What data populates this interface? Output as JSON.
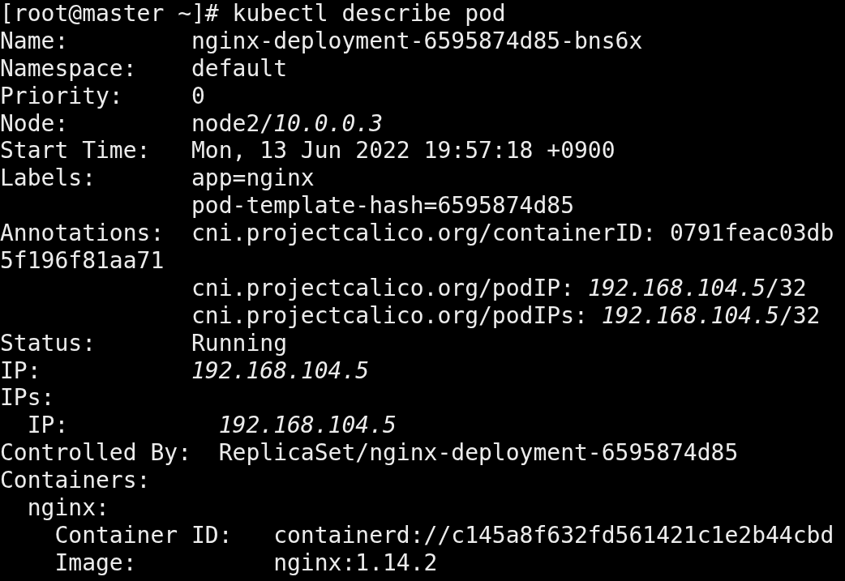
{
  "terminal": {
    "lines": [
      "[root@master ~]# kubectl describe pod",
      "Name:         nginx-deployment-6595874d85-bns6x",
      "Namespace:    default",
      "Priority:     0",
      "Node:         node2/*10.0.0.3*",
      "Start Time:   Mon, 13 Jun 2022 19:57:18 +0900",
      "Labels:       app=nginx",
      "              pod-template-hash=6595874d85",
      "Annotations:  cni.projectcalico.org/containerID: 0791feac03db",
      "5f196f81aa71",
      "              cni.projectcalico.org/podIP: *192.168.104.5*/32",
      "              cni.projectcalico.org/podIPs: *192.168.104.5*/32",
      "Status:       Running",
      "IP:           *192.168.104.5*",
      "IPs:",
      "  IP:           *192.168.104.5*",
      "Controlled By:  ReplicaSet/nginx-deployment-6595874d85",
      "Containers:",
      "  nginx:",
      "    Container ID:   containerd://c145a8f632fd561421c1e2b44cbd",
      "    Image:          nginx:1.14.2"
    ]
  }
}
